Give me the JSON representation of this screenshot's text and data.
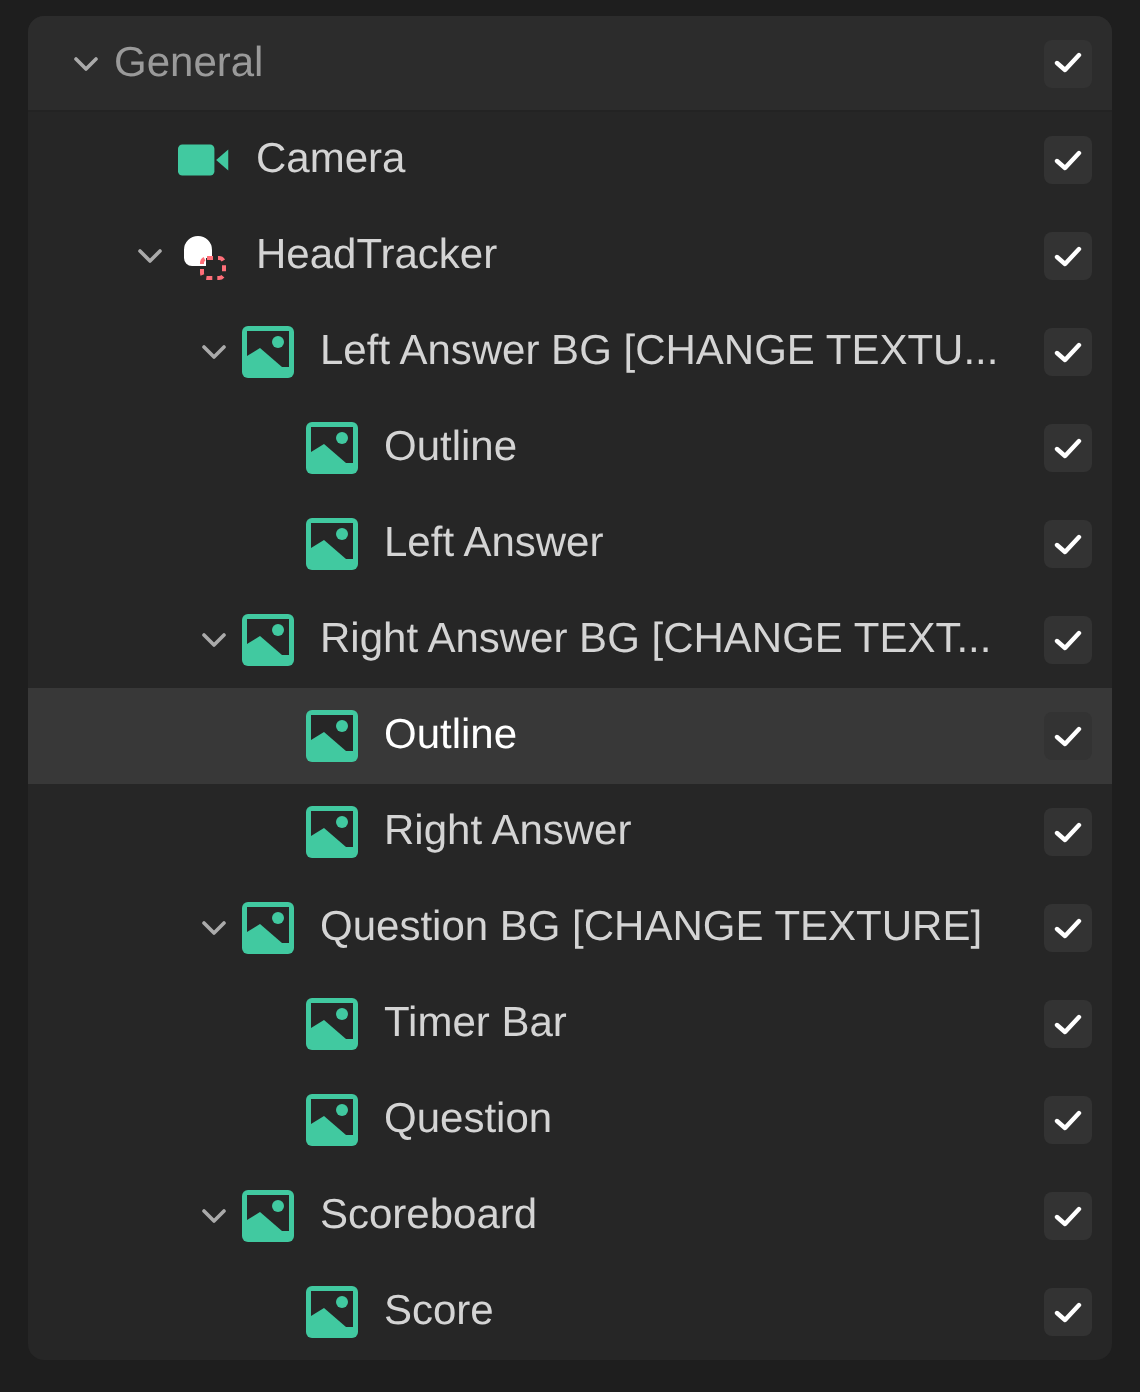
{
  "header": {
    "label": "General",
    "expanded": true,
    "checked": true
  },
  "items": [
    {
      "kind": "camera",
      "label": "Camera",
      "checked": true,
      "selected": false
    },
    {
      "kind": "tracker",
      "label": "HeadTracker",
      "expanded": true,
      "checked": true,
      "selected": false,
      "children": [
        {
          "kind": "image",
          "label": "Left Answer BG [CHANGE TEXTU...",
          "expanded": true,
          "checked": true,
          "selected": false,
          "children": [
            {
              "kind": "image",
              "label": "Outline",
              "checked": true,
              "selected": false
            },
            {
              "kind": "image",
              "label": "Left Answer",
              "checked": true,
              "selected": false
            }
          ]
        },
        {
          "kind": "image",
          "label": "Right Answer BG [CHANGE TEXT...",
          "expanded": true,
          "checked": true,
          "selected": false,
          "children": [
            {
              "kind": "image",
              "label": "Outline",
              "checked": true,
              "selected": true
            },
            {
              "kind": "image",
              "label": "Right Answer",
              "checked": true,
              "selected": false
            }
          ]
        },
        {
          "kind": "image",
          "label": "Question BG [CHANGE TEXTURE]",
          "expanded": true,
          "checked": true,
          "selected": false,
          "children": [
            {
              "kind": "image",
              "label": "Timer Bar",
              "checked": true,
              "selected": false
            },
            {
              "kind": "image",
              "label": "Question",
              "checked": true,
              "selected": false
            }
          ]
        },
        {
          "kind": "image",
          "label": "Scoreboard",
          "expanded": true,
          "checked": true,
          "selected": false,
          "children": [
            {
              "kind": "image",
              "label": "Score",
              "checked": true,
              "selected": false
            }
          ]
        }
      ]
    }
  ]
}
